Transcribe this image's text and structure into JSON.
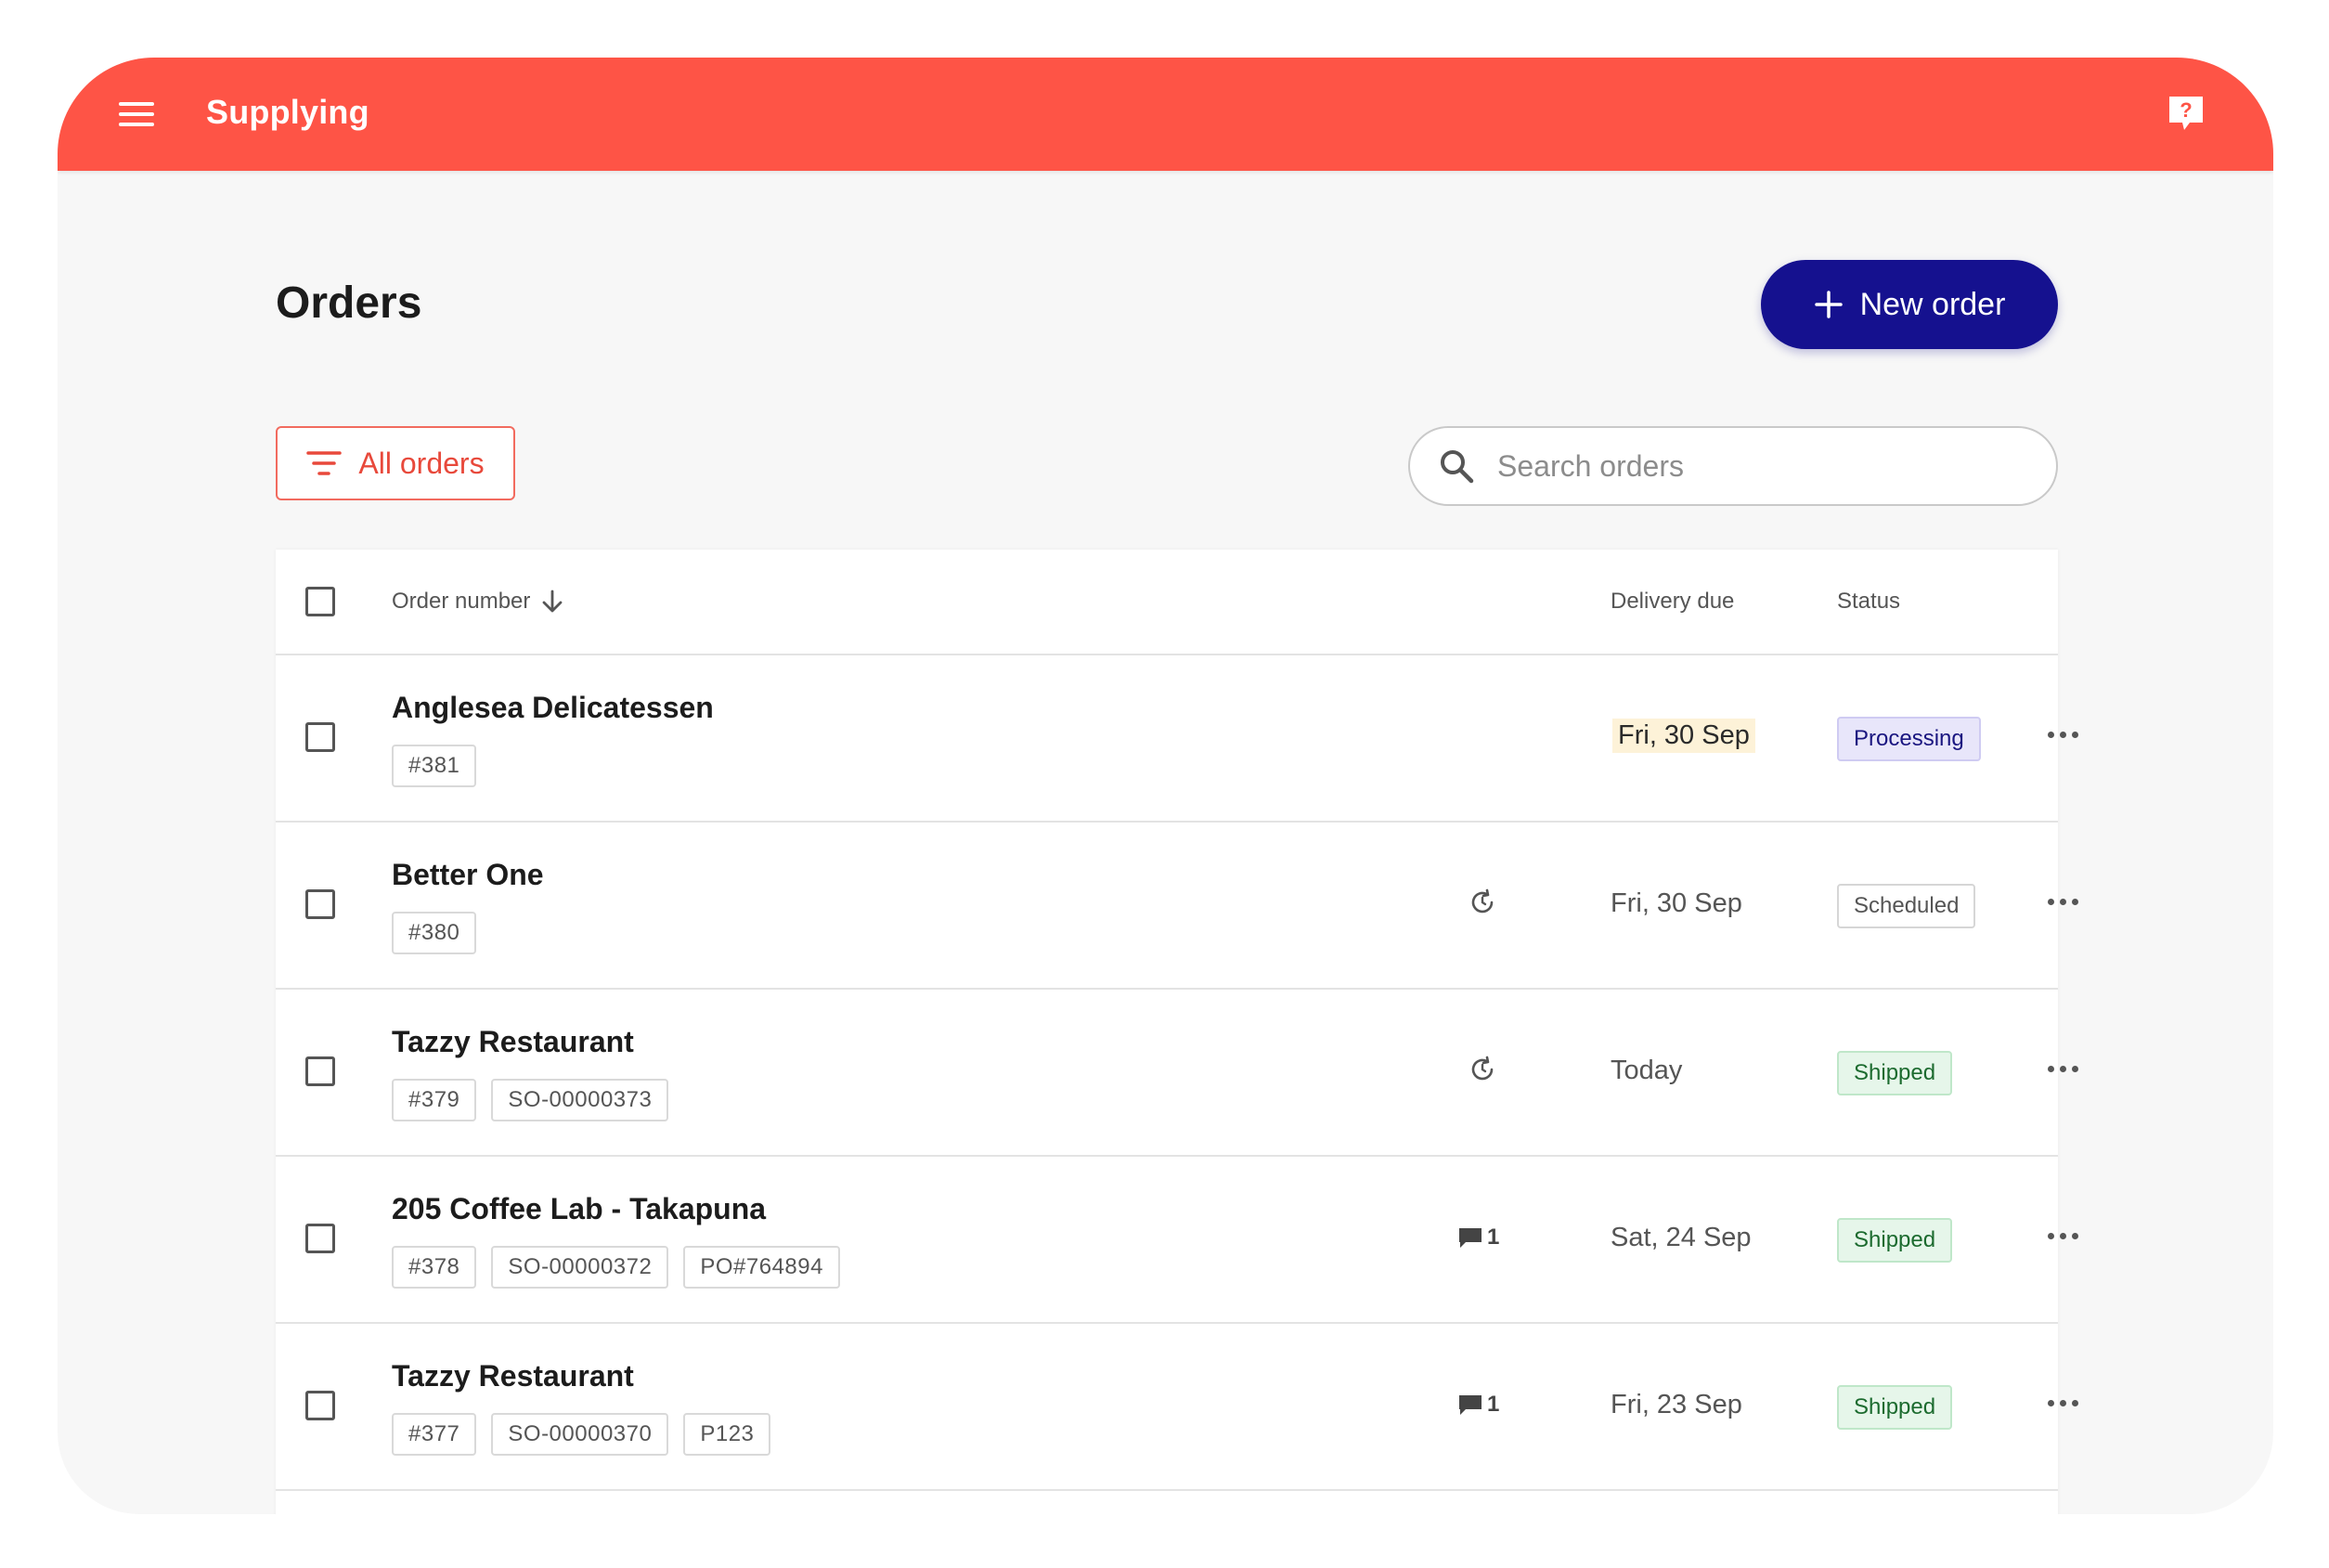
{
  "app": {
    "title": "Supplying"
  },
  "page": {
    "title": "Orders",
    "new_order_label": "New order",
    "filter_label": "All orders",
    "search_placeholder": "Search orders"
  },
  "table": {
    "columns": {
      "order_number": "Order number",
      "delivery_due": "Delivery due",
      "status": "Status"
    },
    "rows": [
      {
        "customer": "Anglesea Delicatessen",
        "tags": [
          "#381"
        ],
        "indicator": null,
        "delivery": "Fri, 30 Sep",
        "delivery_highlight": true,
        "status": "Processing",
        "status_kind": "processing"
      },
      {
        "customer": "Better One",
        "tags": [
          "#380"
        ],
        "indicator": "recurring",
        "delivery": "Fri, 30 Sep",
        "delivery_highlight": false,
        "status": "Scheduled",
        "status_kind": "scheduled"
      },
      {
        "customer": "Tazzy Restaurant",
        "tags": [
          "#379",
          "SO-00000373"
        ],
        "indicator": "recurring",
        "delivery": "Today",
        "delivery_highlight": false,
        "status": "Shipped",
        "status_kind": "shipped"
      },
      {
        "customer": "205 Coffee Lab - Takapuna",
        "tags": [
          "#378",
          "SO-00000372",
          "PO#764894"
        ],
        "indicator": "comment",
        "comment_count": "1",
        "delivery": "Sat, 24 Sep",
        "delivery_highlight": false,
        "status": "Shipped",
        "status_kind": "shipped"
      },
      {
        "customer": "Tazzy Restaurant",
        "tags": [
          "#377",
          "SO-00000370",
          "P123"
        ],
        "indicator": "comment",
        "comment_count": "1",
        "delivery": "Fri, 23 Sep",
        "delivery_highlight": false,
        "status": "Shipped",
        "status_kind": "shipped"
      }
    ]
  },
  "colors": {
    "brand": "#fe5446",
    "primary_button": "#15118f",
    "filter_accent": "#e8493b"
  },
  "icons": {
    "menu": "hamburger-menu-icon",
    "help": "help-chat-icon",
    "add": "plus-icon",
    "filter": "filter-lines-icon",
    "search": "search-icon",
    "sort": "arrow-down-icon",
    "recurring": "recurring-icon",
    "comment": "comment-icon",
    "more": "more-horizontal-icon"
  }
}
